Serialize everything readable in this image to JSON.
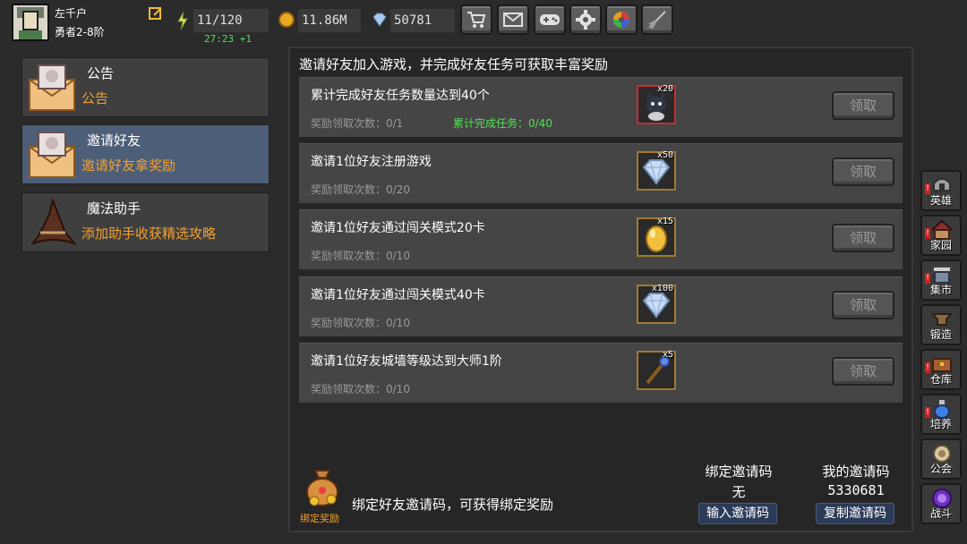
{
  "player": {
    "name": "左千户",
    "rank": "勇者2-8阶"
  },
  "stats": {
    "energy": "11/120",
    "energy_timer": "27:23 +1",
    "gold": "11.86M",
    "gems": "50781"
  },
  "toolbar": {
    "icons": [
      "shop-cart-icon",
      "mail-icon",
      "gamepad-icon",
      "settings-gear-icon",
      "color-wheel-icon",
      "broom-icon"
    ]
  },
  "left_menu": [
    {
      "title": "公告",
      "subtitle": "公告",
      "icon": "envelope-icon"
    },
    {
      "title": "邀请好友",
      "subtitle": "邀请好友拿奖励",
      "icon": "envelope-icon"
    },
    {
      "title": "魔法助手",
      "subtitle": "添加助手收获精选攻略",
      "icon": "wizard-hat-icon"
    }
  ],
  "main": {
    "header": "邀请好友加入游戏，并完成好友任务可获取丰富奖励",
    "tasks": [
      {
        "title": "累计完成好友任务数量达到40个",
        "count": "奖励领取次数：0/1",
        "progress": "累计完成任务：0/40",
        "reward_qty": "x20",
        "reward_icon": "cat-pet-icon",
        "claim": "领取"
      },
      {
        "title": "邀请1位好友注册游戏",
        "count": "奖励领取次数：0/20",
        "progress": "",
        "reward_qty": "x50",
        "reward_icon": "diamond-icon",
        "claim": "领取"
      },
      {
        "title": "邀请1位好友通过闯关模式20卡",
        "count": "奖励领取次数：0/10",
        "progress": "",
        "reward_qty": "x15",
        "reward_icon": "golden-egg-icon",
        "claim": "领取"
      },
      {
        "title": "邀请1位好友通过闯关模式40卡",
        "count": "奖励领取次数：0/10",
        "progress": "",
        "reward_qty": "x100",
        "reward_icon": "diamond-icon",
        "claim": "领取"
      },
      {
        "title": "邀请1位好友城墙等级达到大师1阶",
        "count": "奖励领取次数：0/10",
        "progress": "",
        "reward_qty": "x5",
        "reward_icon": "magic-staff-icon",
        "claim": "领取"
      }
    ]
  },
  "bottom": {
    "bag_label": "绑定奖励",
    "bind_text": "绑定好友邀请码，可获得绑定奖励",
    "bound_code_label": "绑定邀请码",
    "bound_code_value": "无",
    "input_code_button": "输入邀请码",
    "my_code_label": "我的邀请码",
    "my_code_value": "5330681",
    "copy_code_button": "复制邀请码"
  },
  "sidebar": [
    {
      "label": "英雄",
      "icon": "helmet-icon",
      "alert": true
    },
    {
      "label": "家园",
      "icon": "house-icon",
      "alert": true
    },
    {
      "label": "集市",
      "icon": "market-stall-icon",
      "alert": true
    },
    {
      "label": "锻造",
      "icon": "anvil-icon",
      "alert": false
    },
    {
      "label": "仓库",
      "icon": "chest-icon",
      "alert": true
    },
    {
      "label": "培养",
      "icon": "potion-icon",
      "alert": true
    },
    {
      "label": "公会",
      "icon": "guild-icon",
      "alert": false
    },
    {
      "label": "战斗",
      "icon": "portal-icon",
      "alert": false
    }
  ],
  "colors": {
    "accent_orange": "#f0a030",
    "progress_green": "#55e055",
    "active_item_bg": "#4d5e78",
    "code_button_bg": "#2c3c58"
  }
}
